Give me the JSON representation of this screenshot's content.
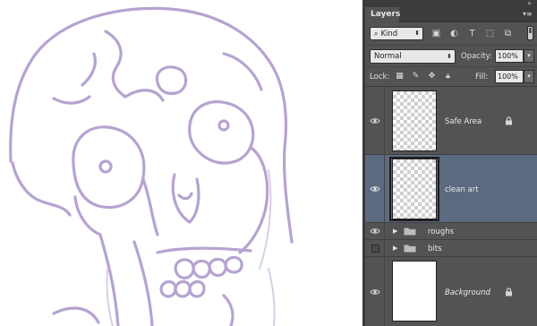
{
  "panel": {
    "tab_label": "Layers",
    "filter": {
      "kind_label": "Kind"
    },
    "blend_mode": "Normal",
    "opacity_label": "Opacity:",
    "opacity_value": "100%",
    "lock_label": "Lock:",
    "fill_label": "Fill:",
    "fill_value": "100%"
  },
  "layers": [
    {
      "name": "Safe Area",
      "visible": true,
      "locked": true,
      "selected": false
    },
    {
      "name": "clean art",
      "visible": true,
      "locked": false,
      "selected": true
    },
    {
      "name": "roughs",
      "type": "group",
      "visible": true
    },
    {
      "name": "bits",
      "type": "group",
      "visible": false
    },
    {
      "name": "Background",
      "visible": true,
      "locked": true,
      "italic": true
    }
  ],
  "colors": {
    "sketch_stroke": "#b6a3d1",
    "panel_bg": "#535353",
    "selected_row": "#5b6a7f"
  }
}
